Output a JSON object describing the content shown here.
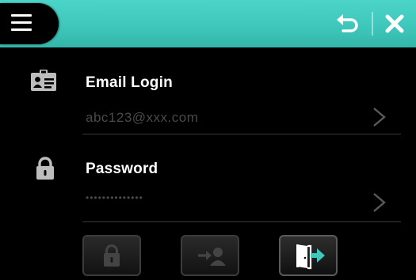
{
  "header": {
    "menu_icon": "hamburger-menu-icon",
    "back_icon": "back-undo-icon",
    "close_icon": "close-x-icon",
    "accent_color": "#3fc7bb"
  },
  "email": {
    "icon": "id-card-icon",
    "label": "Email Login",
    "value": "abc123@xxx.com",
    "chevron_icon": "chevron-right-icon"
  },
  "password": {
    "icon": "padlock-icon",
    "label": "Password",
    "value": "••••••••••••••",
    "chevron_icon": "chevron-right-icon"
  },
  "actions": [
    {
      "icon": "lock-icon",
      "enabled": false
    },
    {
      "icon": "user-login-icon",
      "enabled": false
    },
    {
      "icon": "logout-door-icon",
      "enabled": true
    }
  ]
}
